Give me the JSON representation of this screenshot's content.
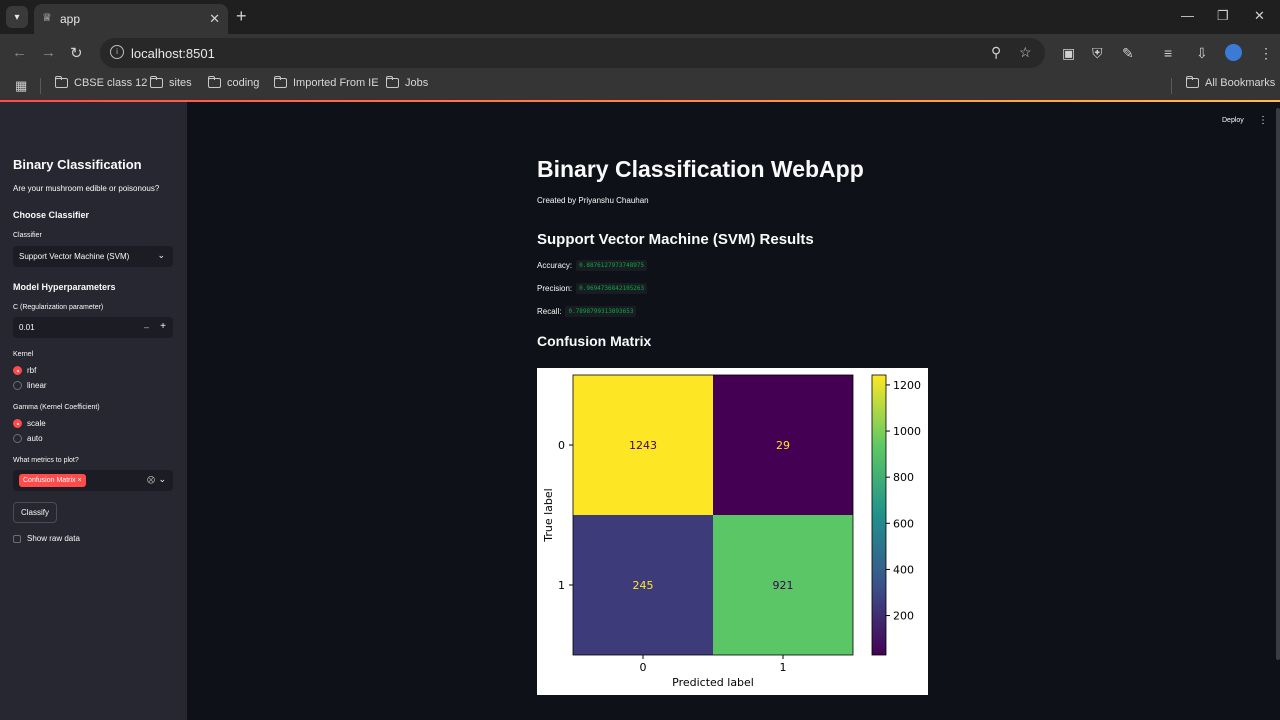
{
  "browser": {
    "tab_title": "app",
    "url": "localhost:8501",
    "bookmarks": [
      "CBSE class 12",
      "sites",
      "coding",
      "Imported From IE",
      "Jobs"
    ],
    "all_bookmarks": "All Bookmarks"
  },
  "header": {
    "deploy_label": "Deploy"
  },
  "sidebar": {
    "title": "Binary Classification",
    "subtitle": "Are your mushroom edible or poisonous?",
    "choose_classifier": "Choose Classifier",
    "classifier_label": "Classifier",
    "classifier_value": "Support Vector Machine (SVM)",
    "hyperparams_title": "Model Hyperparameters",
    "c_label": "C (Regularization parameter)",
    "c_value": "0.01",
    "kernel_label": "Kernel",
    "kernel_options": [
      "rbf",
      "linear"
    ],
    "kernel_selected": "rbf",
    "gamma_label": "Gamma (Kernel Coefficient)",
    "gamma_options": [
      "scale",
      "auto"
    ],
    "gamma_selected": "scale",
    "metrics_label": "What metrics to plot?",
    "metrics_selected": "Confusion Matrix",
    "classify_button": "Classify",
    "show_raw": "Show raw data"
  },
  "main": {
    "title": "Binary Classification WebApp",
    "created_by": "Created by Priyanshu Chauhan",
    "results_title": "Support Vector Machine (SVM) Results",
    "metrics": [
      {
        "label": "Accuracy:",
        "value": "0.8876127973748975"
      },
      {
        "label": "Precision:",
        "value": "0.9694736842105263"
      },
      {
        "label": "Recall:",
        "value": "0.7898799313893653"
      }
    ],
    "cm_title": "Confusion Matrix"
  },
  "chart_data": {
    "type": "heatmap",
    "xlabel": "Predicted label",
    "ylabel": "True label",
    "x_ticks": [
      "0",
      "1"
    ],
    "y_ticks": [
      "0",
      "1"
    ],
    "matrix": [
      [
        1243,
        29
      ],
      [
        245,
        921
      ]
    ],
    "colormap": "viridis",
    "colorbar_ticks": [
      200,
      400,
      600,
      800,
      1000,
      1200
    ]
  }
}
